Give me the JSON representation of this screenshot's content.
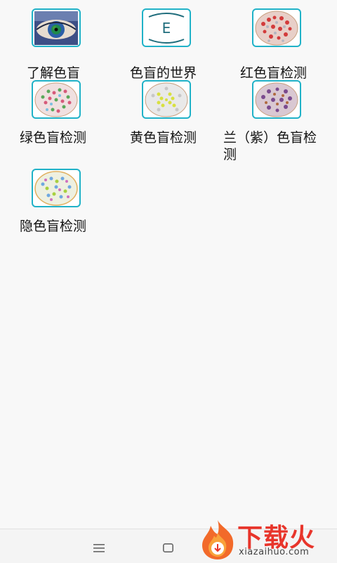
{
  "tiles": [
    {
      "label": "了解色盲",
      "icon": "eye-earth-icon"
    },
    {
      "label": "色盲的世界",
      "icon": "letter-e-chart-icon",
      "glyph": "E"
    },
    {
      "label": "红色盲检测",
      "icon": "red-plate-icon"
    },
    {
      "label": "绿色盲检测",
      "icon": "green-plate-icon"
    },
    {
      "label": "黄色盲检测",
      "icon": "yellow-plate-icon"
    },
    {
      "label": "兰（紫）色盲检测",
      "icon": "purple-plate-icon"
    },
    {
      "label": "隐色盲检测",
      "icon": "hidden-plate-icon"
    }
  ],
  "navbar": {
    "menu_icon": "menu-icon",
    "home_icon": "square-home-icon"
  },
  "watermark": {
    "brand": "下载火",
    "site": "xiazaihuo.com"
  }
}
